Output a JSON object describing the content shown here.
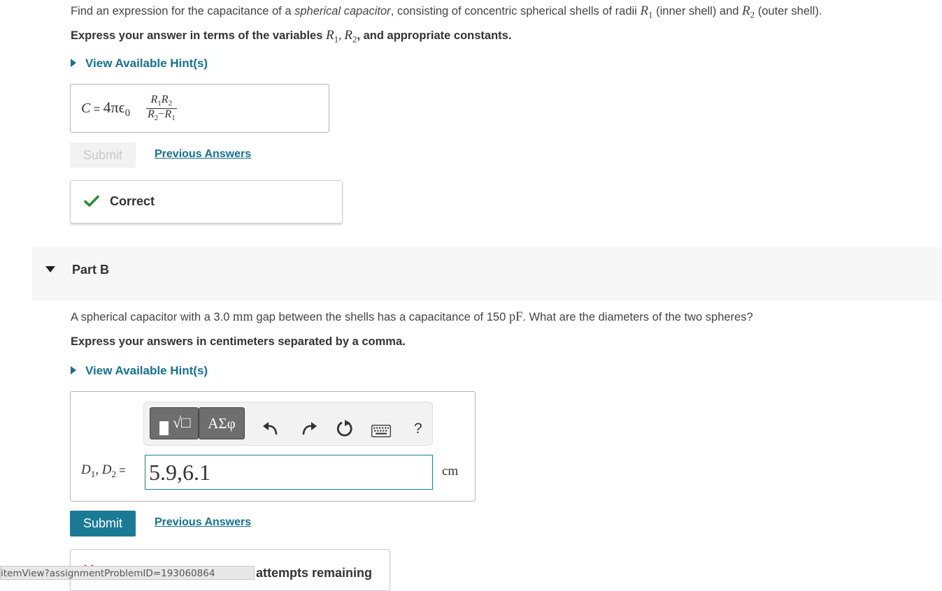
{
  "partA": {
    "question": {
      "t1": "Find an expression for the capacitance of a ",
      "t2": "spherical capacitor",
      "t3": ", consisting of concentric spherical shells of radii ",
      "r1": "R",
      "r1sub": "1",
      "t4": " (inner shell) and ",
      "r2": "R",
      "r2sub": "2",
      "t5": " (outer shell)."
    },
    "instruction": {
      "t1": "Express your answer in terms of the variables ",
      "v1": "R",
      "v1sub": "1",
      "sep1": ", ",
      "v2": "R",
      "v2sub": "2",
      "t2": ", and appropriate constants."
    },
    "hint_label": "View Available Hint(s)",
    "answer": {
      "lhs": "C",
      "eq": " = ",
      "coef": "4πϵ",
      "coef_sub": "0",
      "num_a": "R",
      "num_a_sub": "1",
      "num_b": "R",
      "num_b_sub": "2",
      "den_a": "R",
      "den_a_sub": "2",
      "den_op": "−",
      "den_b": "R",
      "den_b_sub": "1"
    },
    "submit_label": "Submit",
    "previous_answers_label": "Previous Answers",
    "feedback": "Correct"
  },
  "partB": {
    "title": "Part B",
    "question": {
      "t1": "A spherical capacitor with a 3.0 ",
      "u1": "mm",
      "t2": " gap between the shells has a capacitance of 150 ",
      "u2": "pF",
      "t3": ". What are the diameters of the two spheres?"
    },
    "instruction": "Express your answers in centimeters separated by a comma.",
    "hint_label": "View Available Hint(s)",
    "toolbar": {
      "templates_label": "√□",
      "symbols_label": "ΑΣφ",
      "help_label": "?"
    },
    "answer": {
      "lhs_a": "D",
      "lhs_a_sub": "1",
      "lhs_sep": ", ",
      "lhs_b": "D",
      "lhs_b_sub": "2",
      "eq": " = ",
      "value": "5.9,6.1",
      "unit": "cm"
    },
    "submit_label": "Submit",
    "previous_answers_label": "Previous Answers",
    "feedback_partial": "attempts remaining"
  },
  "statusbar": {
    "url": "itemView?assignmentProblemID=193060864"
  },
  "colors": {
    "link": "#16718f",
    "submit_active": "#1a7a96",
    "check": "#2e8b3a",
    "partbar": "#f7f7f7"
  }
}
